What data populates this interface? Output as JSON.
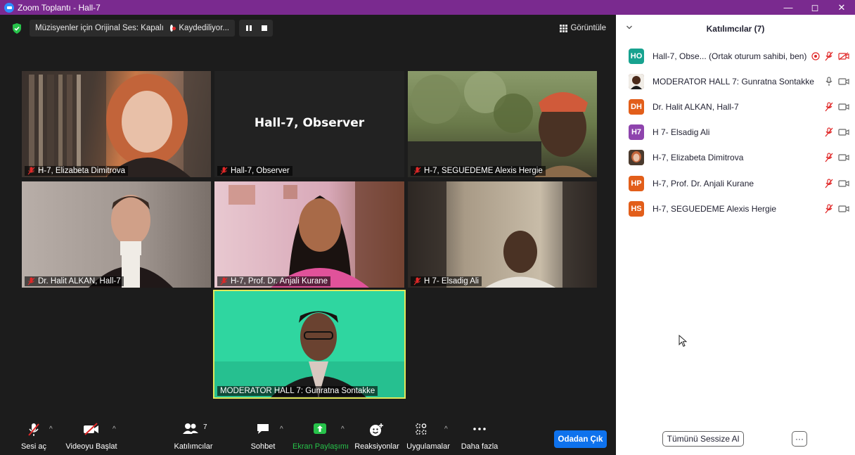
{
  "window": {
    "title": "Zoom Toplantı - Hall-7",
    "minimize": "—",
    "restore": "◻",
    "close": "✕"
  },
  "topbar": {
    "audio_status": "Müzisyenler için Orijinal Ses: Kapalı",
    "recording": "Kaydediliyor...",
    "view_label": "Görüntüle"
  },
  "tiles": [
    {
      "id": "elizabeta",
      "name": "H-7, Elizabeta Dimitrova",
      "muted": true,
      "bg": "#4a3a2e"
    },
    {
      "id": "observer",
      "name": "Hall-7, Observer",
      "muted": true,
      "display_name": "Hall-7, Observer",
      "bg": "#222222"
    },
    {
      "id": "seguedeme",
      "name": "H-7, SEGUEDEME Alexis Hergie",
      "muted": true,
      "bg": "#6a7a4a"
    },
    {
      "id": "halit",
      "name": "Dr. Halit ALKAN, Hall-7",
      "muted": true,
      "bg": "#a89e98"
    },
    {
      "id": "anjali",
      "name": "H-7, Prof. Dr. Anjali Kurane",
      "muted": true,
      "bg": "#d8a4b8"
    },
    {
      "id": "elsadig",
      "name": "H 7- Elsadig Ali",
      "muted": true,
      "bg": "#8a7e6a"
    },
    {
      "id": "gunratna",
      "name": "MODERATOR HALL 7: Gunratna Sontakke",
      "muted": false,
      "bg": "#33d9a6",
      "active": true
    }
  ],
  "toolbar": {
    "unmute": "Sesi aç",
    "start_video": "Videoyu Başlat",
    "participants": "Katılımcılar",
    "participant_count": "7",
    "chat": "Sohbet",
    "share": "Ekran Paylaşımı",
    "reactions": "Reaksiyonlar",
    "apps": "Uygulamalar",
    "more": "Daha fazla",
    "leave": "Odadan Çık"
  },
  "panel": {
    "title": "Katılımcılar (7)",
    "mute_all": "Tümünü Sessize Al",
    "more": "···",
    "participants": [
      {
        "initials": "HO",
        "color": "#17a28f",
        "name": "Hall-7, Obse...  (Ortak oturum sahibi, ben)",
        "mic": "muted",
        "video": "off",
        "recording": true
      },
      {
        "initials": "",
        "color": "#6b3a2a",
        "name": "MODERATOR HALL 7: Gunratna Sontakke",
        "mic": "on",
        "video": "on",
        "photo": true
      },
      {
        "initials": "DH",
        "color": "#e25e1a",
        "name": "Dr. Halit ALKAN, Hall-7",
        "mic": "muted",
        "video": "on"
      },
      {
        "initials": "H7",
        "color": "#8e44ad",
        "name": "H 7- Elsadig Ali",
        "mic": "muted",
        "video": "on"
      },
      {
        "initials": "",
        "color": "#c8a070",
        "name": "H-7, Elizabeta Dimitrova",
        "mic": "muted",
        "video": "on",
        "photo": true
      },
      {
        "initials": "HP",
        "color": "#e25e1a",
        "name": "H-7, Prof. Dr. Anjali Kurane",
        "mic": "muted",
        "video": "on"
      },
      {
        "initials": "HS",
        "color": "#e25e1a",
        "name": "H-7, SEGUEDEME Alexis Hergie",
        "mic": "muted",
        "video": "on"
      }
    ]
  }
}
